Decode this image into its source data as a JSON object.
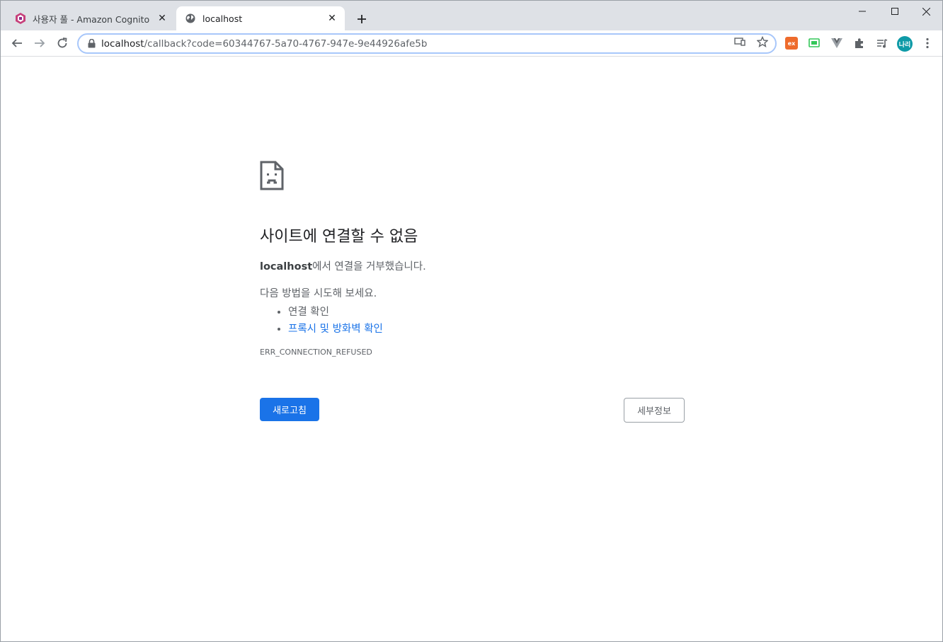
{
  "tabs": [
    {
      "title": "사용자 풀 - Amazon Cognito",
      "favicon": "cognito-icon",
      "active": false
    },
    {
      "title": "localhost",
      "favicon": "globe-icon",
      "active": true
    }
  ],
  "toolbar": {
    "url_host": "localhost",
    "url_rest": "/callback?code=60344767-5a70-4767-947e-9e44926afe5b"
  },
  "extensions": {
    "ext1_label": "ex",
    "avatar_label": "나리"
  },
  "error_page": {
    "heading": "사이트에 연결할 수 없음",
    "host": "localhost",
    "description_suffix": "에서 연결을 거부했습니다.",
    "suggest_title": "다음 방법을 시도해 보세요.",
    "suggestions": [
      {
        "label": "연결 확인",
        "link": false
      },
      {
        "label": "프록시 및 방화벽 확인",
        "link": true
      }
    ],
    "error_code": "ERR_CONNECTION_REFUSED",
    "reload_label": "새로고침",
    "details_label": "세부정보"
  },
  "colors": {
    "accent": "#1a73e8",
    "tabstrip": "#dee1e6",
    "ext1": "#ee6b2c",
    "ext2": "#34c759",
    "avatar": "#0e9aa7"
  }
}
